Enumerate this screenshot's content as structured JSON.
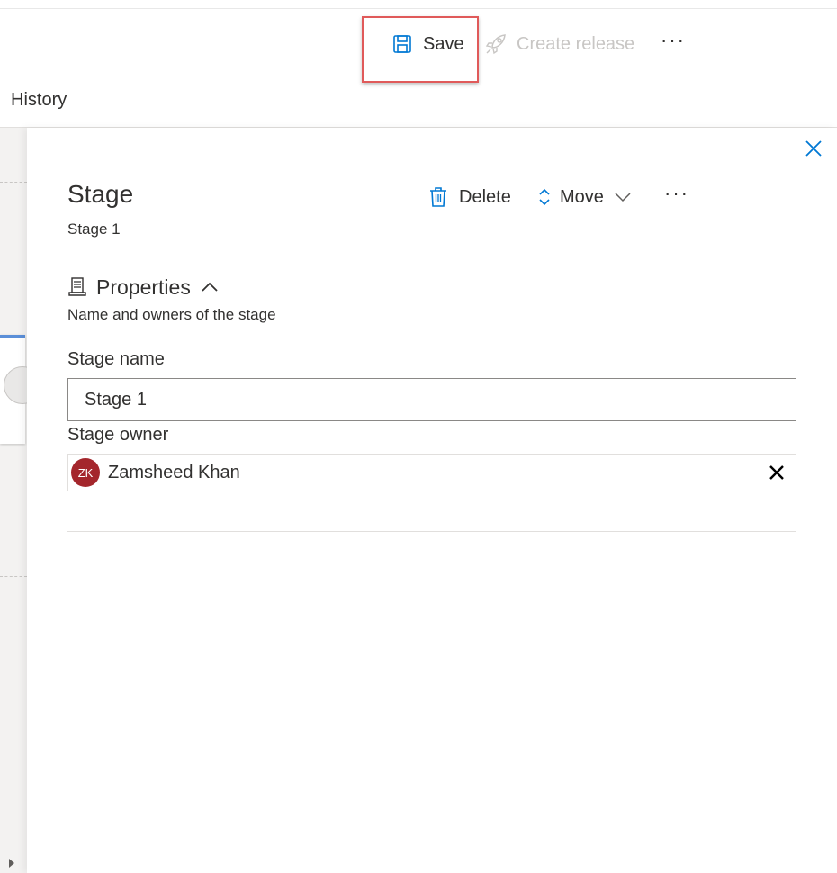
{
  "toolbar": {
    "save_label": "Save",
    "create_release_label": "Create release",
    "more_label": "···",
    "save_icon": "save-icon",
    "release_icon": "rocket-icon"
  },
  "tabs": {
    "history_label": "History"
  },
  "panel": {
    "title": "Stage",
    "subtitle": "Stage 1",
    "actions": {
      "delete_label": "Delete",
      "move_label": "Move",
      "more_label": "···"
    },
    "properties": {
      "heading": "Properties",
      "description": "Name and owners of the stage",
      "stage_name_label": "Stage name",
      "stage_name_value": "Stage 1",
      "stage_owner_label": "Stage owner",
      "owner": {
        "initials": "ZK",
        "name": "Zamsheed Khan",
        "avatar_color": "#a4262c"
      }
    }
  },
  "colors": {
    "accent": "#0078d4",
    "highlight_border": "#e05a5a",
    "disabled_text": "#c8c6c4"
  }
}
